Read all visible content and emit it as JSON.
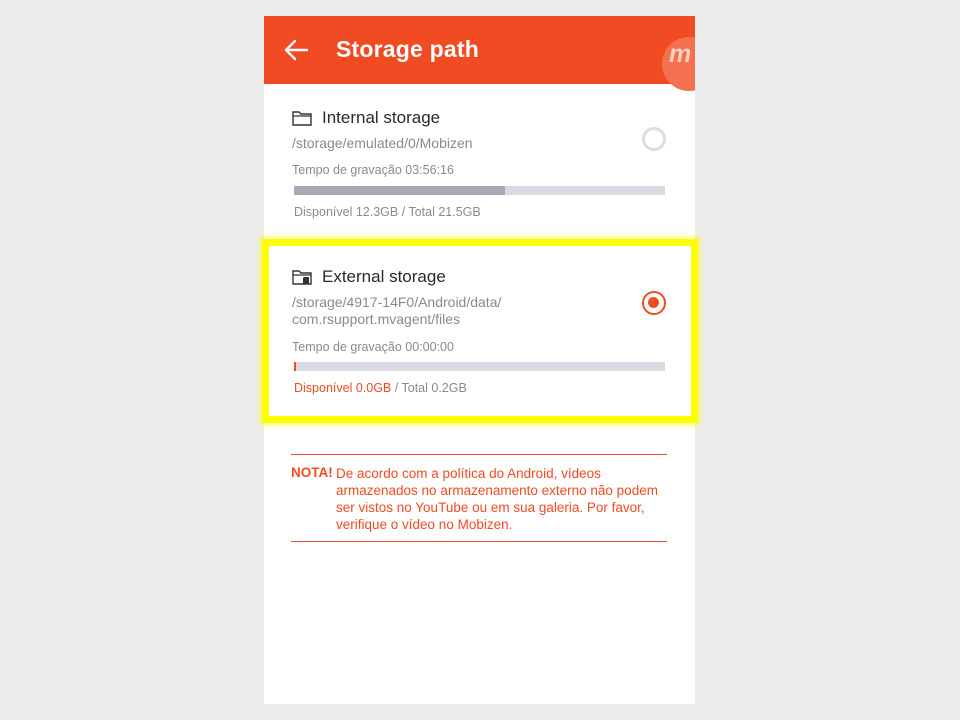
{
  "appbar": {
    "title": "Storage path",
    "back_icon": "arrow-left-icon",
    "brand_letter": "m",
    "color": "#f04b23"
  },
  "storage_options": [
    {
      "title": "Internal storage",
      "icon": "folder-icon",
      "path": "/storage/emulated/0/Mobizen",
      "record_time": "Tempo de gravação 03:56:16",
      "available": "Disponível 12.3GB",
      "total": "Total 21.5GB",
      "usage_fraction": 0.57,
      "selected": false
    },
    {
      "title": "External storage",
      "icon": "sd-card-folder-icon",
      "path_line1": "/storage/4917-14F0/Android/data/",
      "path_line2": "com.rsupport.mvagent/files",
      "record_time": "Tempo de gravação 00:00:00",
      "available": "Disponível 0.0GB",
      "total": "Total 0.2GB",
      "usage_fraction": 0.005,
      "selected": true
    }
  ],
  "stats_separator": "/",
  "note": {
    "label": "NOTA!",
    "text": "De acordo com a política do Android, vídeos armazenados no armazenamento externo não podem ser vistos no YouTube ou em sua galeria. Por favor, verifique o vídeo no Mobizen."
  },
  "colors": {
    "accent": "#f04b23",
    "highlight": "#ffff00",
    "bar_track": "#d8dbe3",
    "bar_fill": "#a8abb7"
  }
}
